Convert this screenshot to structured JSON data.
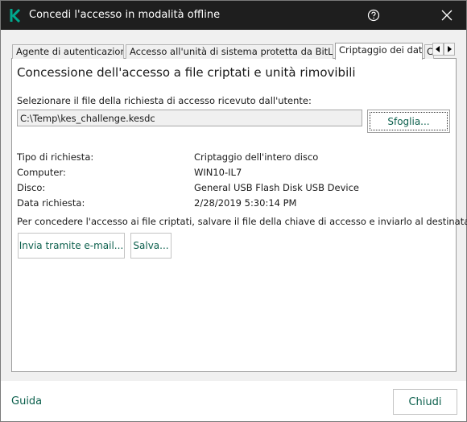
{
  "window": {
    "title": "Concedi l'accesso in modalità offline",
    "logo_icon": "kaspersky-k-logo",
    "help_icon": "help-icon",
    "close_icon": "close-icon"
  },
  "tabs": [
    {
      "label": "Agente di autenticazione",
      "active": false
    },
    {
      "label": "Accesso all'unità di sistema protetta da BitLocker",
      "active": false
    },
    {
      "label": "Criptaggio dei dati",
      "active": true
    },
    {
      "label": "C",
      "active": false
    }
  ],
  "tab_scroll": {
    "left_icon": "chevron-left-icon",
    "right_icon": "chevron-right-icon"
  },
  "main": {
    "heading": "Concessione dell'accesso a file criptati e unità rimovibili",
    "select_label": "Selezionare il file della richiesta di accesso ricevuto dall'utente:",
    "file_path": "C:\\Temp\\kes_challenge.kesdc",
    "browse_label": "Sfoglia...",
    "details": [
      {
        "label": "Tipo di richiesta:",
        "value": "Criptaggio dell'intero disco"
      },
      {
        "label": "Computer:",
        "value": "WIN10-IL7"
      },
      {
        "label": "Disco:",
        "value": "General USB Flash Disk USB Device"
      },
      {
        "label": "Data richiesta:",
        "value": "2/28/2019 5:30:14 PM"
      }
    ],
    "instruction": "Per concedere l'accesso ai file criptati, salvare il file della chiave di accesso e inviarlo al destinatario.",
    "email_button": "Invia tramite e-mail...",
    "save_button": "Salva..."
  },
  "footer": {
    "help_link": "Guida",
    "close_button": "Chiudi"
  },
  "colors": {
    "titlebar_bg": "#1e1e1e",
    "accent_green": "#0b5f4c",
    "logo_green": "#00a88e"
  }
}
